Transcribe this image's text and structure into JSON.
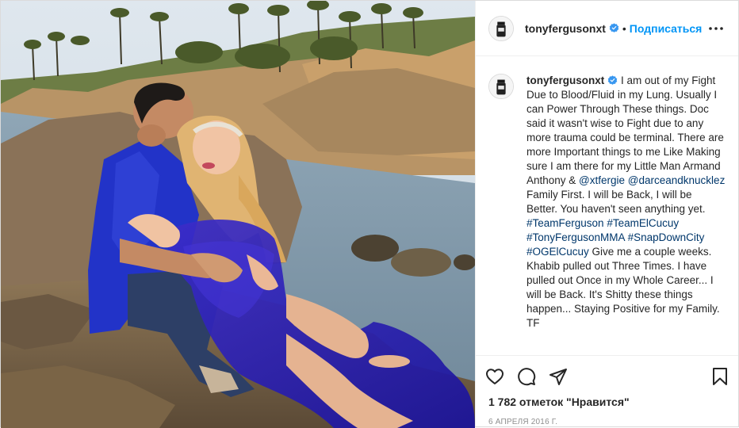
{
  "post": {
    "username": "tonyfergusonxt",
    "follow_label": "Подписаться",
    "separator": "•",
    "caption": {
      "username": "tonyfergusonxt",
      "text_1": " I am out of my Fight Due to Blood/Fluid in my Lung. Usually I can Power Through These things. Doc said it wasn't wise to Fight due to any more trauma could be terminal. There are more Important things to me Like Making sure I am there for my Little Man Armand Anthony & ",
      "mention_1": "@xtfergie",
      "space": " ",
      "mention_2": "@darceandknucklez",
      "text_2": " Family First. I will be Back, I will be Better. You haven't seen anything yet. ",
      "hashtag_1": "#TeamFerguson",
      "hashtag_2": "#TeamElCucuy",
      "hashtag_3": "#TonyFergusonMMA",
      "hashtag_4": "#SnapDownCity",
      "hashtag_5": "#OGElCucuy",
      "text_3": " Give me a couple weeks. Khabib pulled out Three Times. I have pulled out Once in my Whole Career... I will be Back. It's Shitty these things happen... Staying Positive for my Family. TF"
    },
    "likes_text": "1 782 отметок \"Нравится\"",
    "date_text": "6 апреля 2016 г."
  },
  "icons": {
    "verified": "verified-badge-icon",
    "more": "more-options-icon",
    "like": "heart-icon",
    "comment": "comment-icon",
    "share": "share-icon",
    "save": "bookmark-icon"
  },
  "colors": {
    "link": "#00376b",
    "follow": "#0095f6",
    "verified": "#3897f0",
    "muted": "#8e8e8e"
  }
}
